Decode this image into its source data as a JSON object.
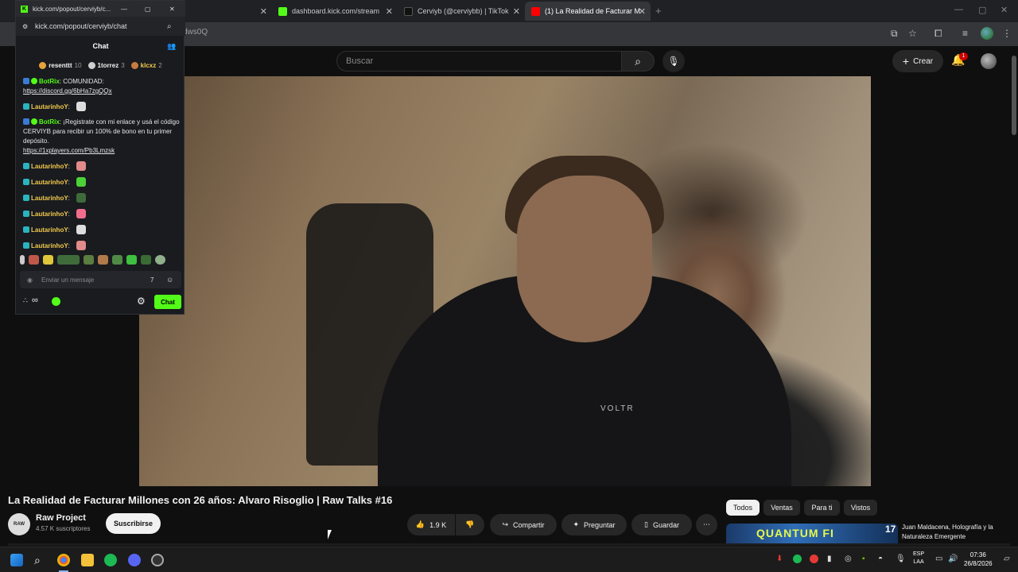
{
  "browser": {
    "tabs": [
      {
        "label": "",
        "icon": "generic-tab"
      },
      {
        "label": "dashboard.kick.com/stream",
        "icon": "kick-icon"
      },
      {
        "label": "Cerviyb (@cerviybb) | TikTok",
        "icon": "tiktok-icon"
      },
      {
        "label": "(1) La Realidad de Facturar M",
        "icon": "youtube-icon",
        "active": true
      }
    ],
    "url_fragment": "dws0Q"
  },
  "chat_popout": {
    "window_title": "kick.com/popout/cerviyb/c...",
    "url": "kick.com/popout/cerviyb/chat",
    "header": "Chat",
    "leaderboard": [
      {
        "name": "resenttt",
        "count": "10",
        "color": "#e6a23c"
      },
      {
        "name": "1torrez",
        "count": "3",
        "color": "#cfcfcf"
      },
      {
        "name": "klcxz",
        "count": "2",
        "color": "#c77b41"
      }
    ],
    "messages": [
      {
        "user": "BotRix",
        "text": "COMUNIDAD:",
        "link": "https://discord.gg/6bHa7zgQQx"
      },
      {
        "user": "LautarinhoY",
        "text": "",
        "emote": "#ddd"
      },
      {
        "user": "BotRix",
        "text": "¡Registrate con mi enlace y usá el código CERVIYB para recibir un 100% de bono en tu primer depósito.",
        "link": "https://1xplayers.com/Pb3Lmzsk"
      },
      {
        "user": "LautarinhoY",
        "text": "",
        "emote": "#e38a8a"
      },
      {
        "user": "LautarinhoY",
        "text": "",
        "emote": "#4cd137"
      },
      {
        "user": "LautarinhoY",
        "text": "",
        "emote": "#3f6b3a"
      },
      {
        "user": "LautarinhoY",
        "text": "",
        "emote": "#f26d8d"
      },
      {
        "user": "LautarinhoY",
        "text": "",
        "emote": "#ddd"
      },
      {
        "user": "LautarinhoY",
        "text": "",
        "emote": "#e38a8a"
      }
    ],
    "input_placeholder": "Enviar un mensaje",
    "send_label": "Chat",
    "footer_infinity": "∞"
  },
  "youtube": {
    "search_placeholder": "Buscar",
    "create_label": "Crear",
    "notification_count": "1",
    "video_title": "La Realidad de Facturar Millones con 26 años: Alvaro Risoglio | Raw Talks #16",
    "channel": {
      "name": "Raw Project",
      "subscribers": "4.57 K suscriptores",
      "avatar_text": "RAW"
    },
    "subscribe_label": "Suscribirse",
    "actions": {
      "likes": "1.9 K",
      "share": "Compartir",
      "ask": "Preguntar",
      "save": "Guardar"
    },
    "filter_chips": [
      "Todos",
      "Ventas",
      "Para ti",
      "Vistos"
    ],
    "recommendation": {
      "title": "Juan Maldacena, Holografía y la Naturaleza Emergente",
      "thumb_text": "QUANTUM FI",
      "thumb_badge": "17"
    },
    "shirt_logo": "VOLTR"
  },
  "taskbar": {
    "language": "ESP",
    "language_sub": "LAA",
    "time": "07:36",
    "date": "26/8/2026"
  }
}
